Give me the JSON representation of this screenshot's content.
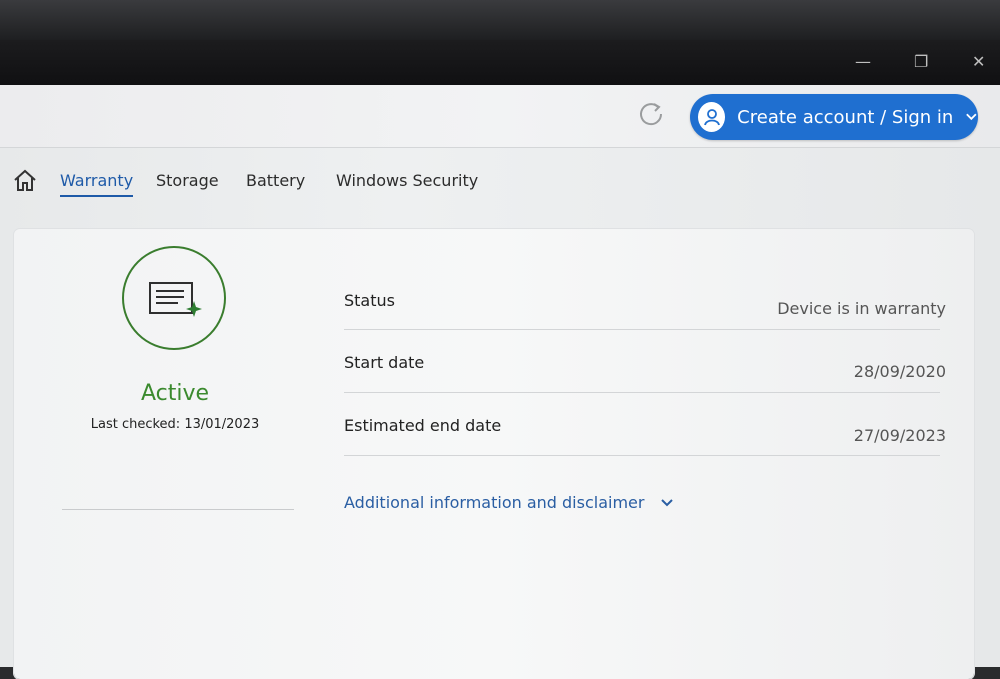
{
  "window": {
    "minimize_glyph": "—",
    "maximize_glyph": "❐",
    "close_glyph": "✕"
  },
  "header": {
    "account_button_label": "Create account / Sign in",
    "icons": [
      "refresh-icon",
      "user-icon",
      "chevron-down-icon"
    ]
  },
  "tabs": {
    "home_icon": "home-icon",
    "items": [
      {
        "label": "Warranty",
        "active": true
      },
      {
        "label": "Storage",
        "active": false
      },
      {
        "label": "Battery",
        "active": false
      },
      {
        "label": "Windows Security",
        "active": false
      }
    ]
  },
  "warranty": {
    "status_title": "Active",
    "last_checked": "Last checked: 13/01/2023",
    "status_icon": "document-sparkle-icon",
    "rows": [
      {
        "label": "Status",
        "value": "Device is in warranty"
      },
      {
        "label": "Start date",
        "value": "28/09/2020"
      },
      {
        "label": "Estimated end date",
        "value": "27/09/2023"
      }
    ],
    "disclaimer_link": "Additional information and disclaimer"
  },
  "colors": {
    "accent": "#1f6fd0",
    "active_green": "#3b8a2e",
    "link_blue": "#2a5ea3"
  }
}
